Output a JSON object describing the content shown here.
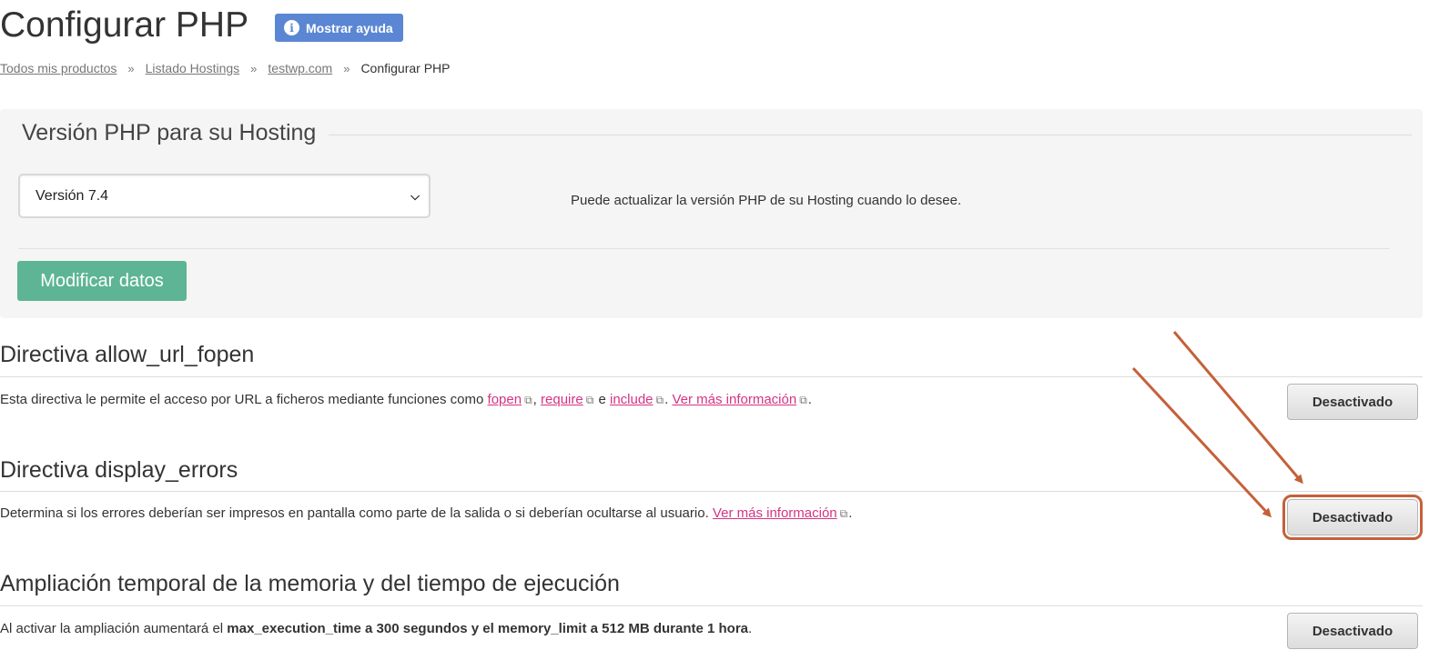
{
  "header": {
    "title": "Configurar PHP",
    "help_label": "Mostrar ayuda"
  },
  "breadcrumb": {
    "items": [
      "Todos mis productos",
      "Listado Hostings",
      "testwp.com"
    ],
    "current": "Configurar PHP",
    "separator": "»"
  },
  "php_panel": {
    "legend": "Versión PHP para su Hosting",
    "selected_version": "Versión 7.4",
    "hint": "Puede actualizar la versión PHP de su Hosting cuando lo desee.",
    "submit_label": "Modificar datos"
  },
  "sections": [
    {
      "title": "Directiva allow_url_fopen",
      "desc_prefix": "Esta directiva le permite el acceso por URL a ficheros mediante funciones como ",
      "link_fopen": "fopen",
      "sep_comma": ",",
      "link_require": "require",
      "sep_e": " e ",
      "link_include": "include",
      "sep_dot": ". ",
      "link_more": "Ver más información",
      "desc_end": ".",
      "button": "Desactivado"
    },
    {
      "title": "Directiva display_errors",
      "desc_prefix": "Determina si los errores deberían ser impresos en pantalla como parte de la salida o si deberían ocultarse al usuario. ",
      "link_more": "Ver más información",
      "desc_end": ".",
      "button": "Desactivado"
    },
    {
      "title": "Ampliación temporal de la memoria y del tiempo de ejecución",
      "desc_prefix": "Al activar la ampliación aumentará el ",
      "desc_bold": "max_execution_time a 300 segundos y el memory_limit a 512 MB durante 1 hora",
      "desc_end": ".",
      "button": "Desactivado"
    }
  ],
  "icons": {
    "info": "info-icon",
    "external_link": "external-link-icon",
    "chevron": "chevron-down-icon"
  },
  "colors": {
    "help_button": "#5b86d4",
    "submit_button": "#5db595",
    "link": "#d63384",
    "annotation": "#c5603a"
  }
}
